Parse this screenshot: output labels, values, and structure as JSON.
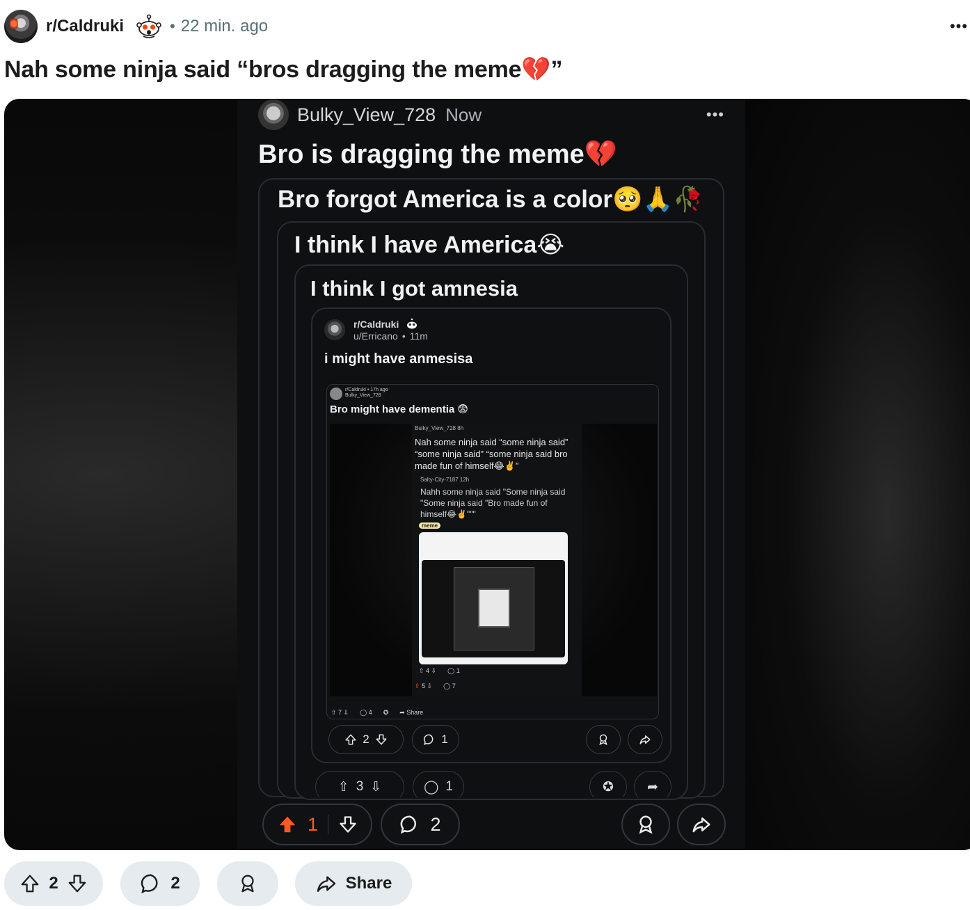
{
  "post": {
    "subreddit": "r/Caldruki",
    "separator": "•",
    "time": "22 min. ago",
    "title": "Nah some ninja said “bros dragging the meme💔”",
    "more_glyph": "•••"
  },
  "media": {
    "user": "Bulky_View_728",
    "time": "Now",
    "more_glyph": "•••",
    "title": "Bro is dragging the meme💔",
    "nested": [
      "Bro forgot America is a color🥺🙏🥀",
      "I think I have America😭",
      "I think I got amnesia"
    ],
    "inner": {
      "subreddit": "r/Caldruki",
      "user": "u/Erricano",
      "separator": "•",
      "time": "11m",
      "title": "i might have anmesisa",
      "deep_meta_sub": "r/Caldruki • 17h ago",
      "deep_meta_user": "Bulky_View_728",
      "deep_title": "Bro might have dementia 😨",
      "level3_user": "Bulky_View_728  8h",
      "level3_text": "Nah some ninja said “some ninja said” “some ninja said” “some ninja said bro made fun of himself😂✌️”",
      "level4_user": "Salty-City-7187  12h",
      "level4_text": "Nahh some ninja said \"Some ninja said \"Some ninja said \"Bro made fun of himself😂✌️\"\"\"",
      "tag": "meme",
      "deep_actions_1": [
        "4",
        "1"
      ],
      "deep_actions_2": [
        "5",
        "7"
      ],
      "deep_footer": [
        "7",
        "4",
        "Share"
      ],
      "upvotes": "2",
      "comments": "1"
    },
    "ghost_actions": {
      "upvotes": "3",
      "comments": "1"
    },
    "actions": {
      "upvotes": "1",
      "comments": "2"
    }
  },
  "actions": {
    "upvotes": "2",
    "comments": "2",
    "share": "Share"
  },
  "colors": {
    "upvote_active": "#ff5a1f",
    "pill_bg": "#e5ebee",
    "meta": "#576f76"
  },
  "icons": [
    "snoo-icon",
    "upvote-icon",
    "downvote-icon",
    "comment-icon",
    "award-icon",
    "share-icon",
    "more-icon"
  ]
}
